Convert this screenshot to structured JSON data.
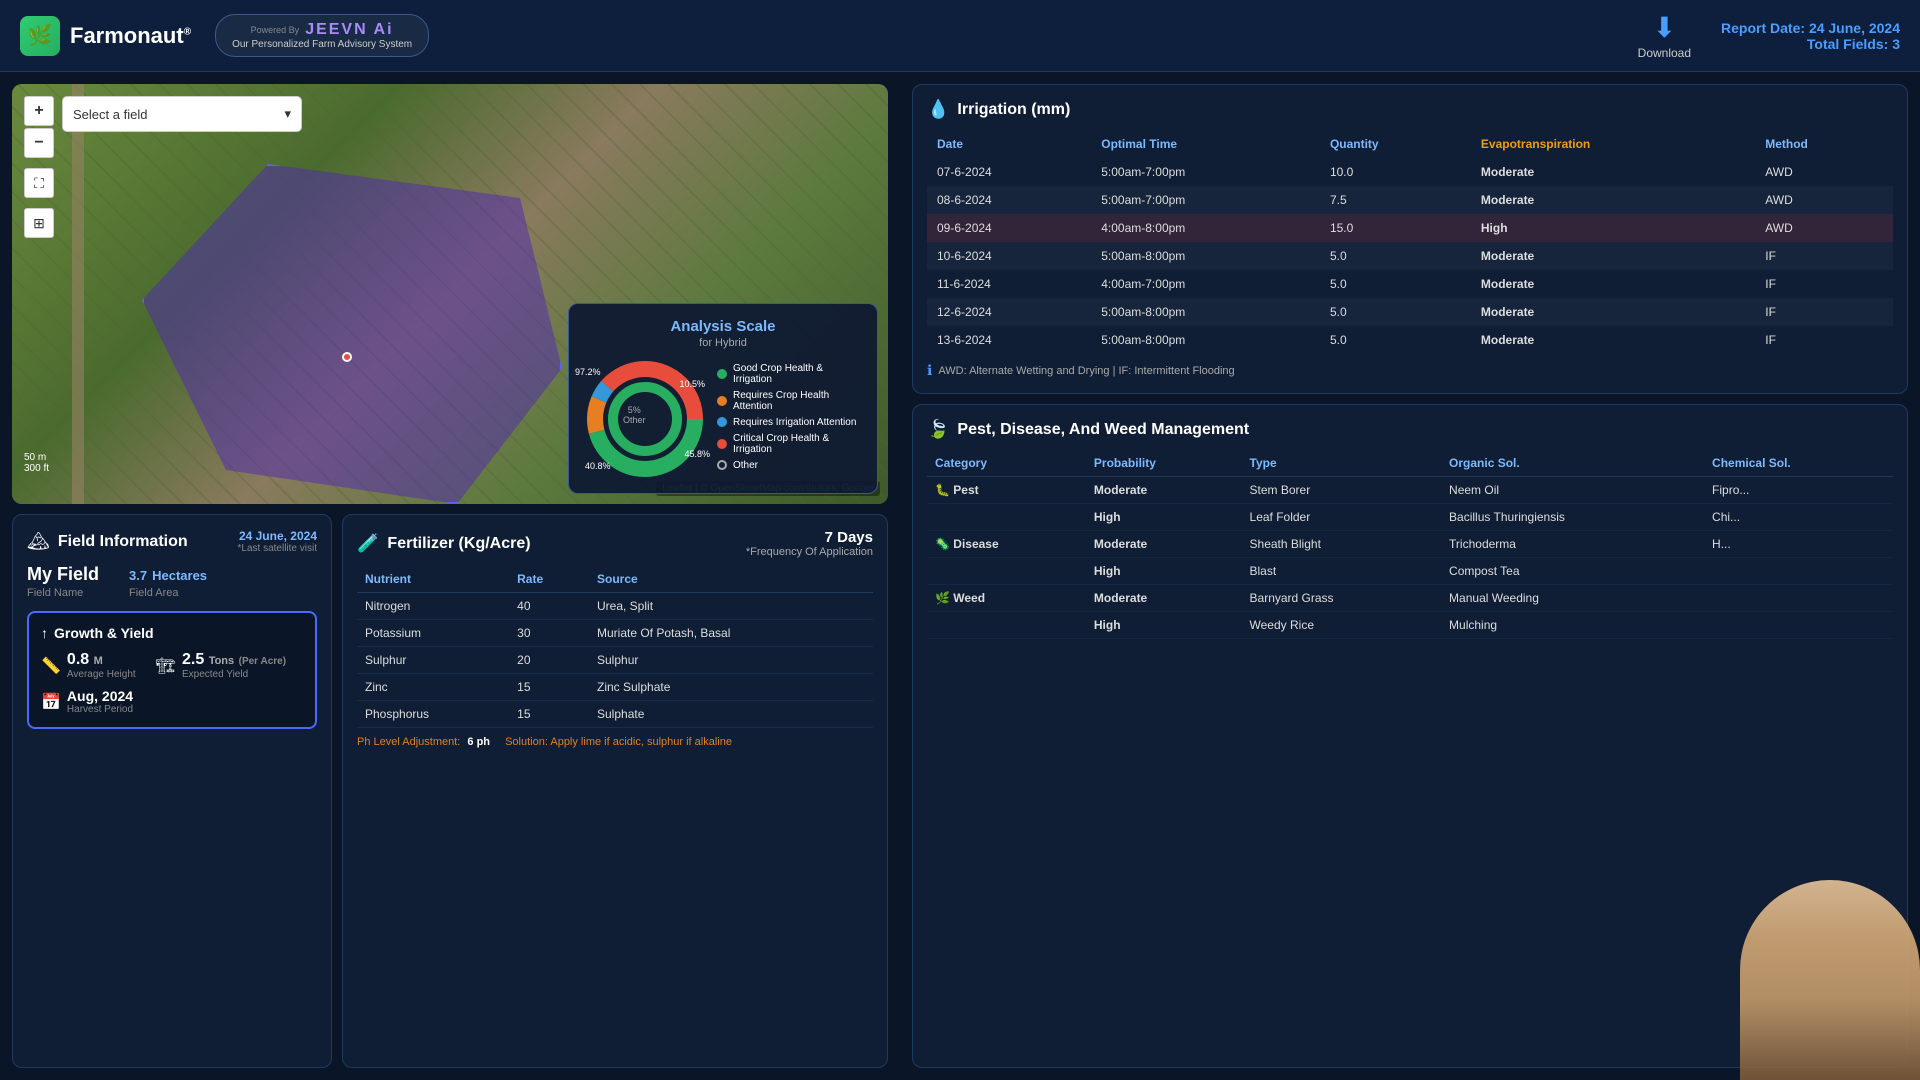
{
  "header": {
    "logo_text": "Farmonaut",
    "logo_reg": "®",
    "jeevn_title": "JEEVN Ai",
    "powered_by": "Powered By",
    "jeevn_subtitle": "Our Personalized Farm Advisory System",
    "download_label": "Download",
    "report_date_label": "Report Date:",
    "report_date_value": "24 June, 2024",
    "total_fields_label": "Total Fields:",
    "total_fields_value": "3"
  },
  "map": {
    "field_select_placeholder": "Select a field",
    "zoom_in": "+",
    "zoom_out": "−",
    "scale_50m": "50 m",
    "scale_300ft": "300 ft",
    "attribution": "Leaflet | © OpenStreetMap contributors, Google"
  },
  "analysis_scale": {
    "title": "Analysis Scale",
    "subtitle": "for Hybrid",
    "percentage_97": "97.2%",
    "percentage_105": "10.5%",
    "percentage_458": "45.8%",
    "percentage_5": "5%",
    "other_label": "Other",
    "percentage_408": "40.8%",
    "legend": [
      {
        "color": "#27ae60",
        "label": "Good Crop Health & Irrigation"
      },
      {
        "color": "#e67e22",
        "label": "Requires Crop Health Attention"
      },
      {
        "color": "#3498db",
        "label": "Requires Irrigation Attention"
      },
      {
        "color": "#e74c3c",
        "label": "Critical Crop Health & Irrigation"
      },
      {
        "color": "#ccc",
        "label": "Other",
        "type": "ring"
      }
    ]
  },
  "field_info": {
    "title": "Field Information",
    "date": "24 June, 2024",
    "date_label": "*Last satellite visit",
    "field_name": "My Field",
    "field_name_label": "Field Name",
    "field_area": "3.7",
    "field_area_unit": "Hectares",
    "field_area_label": "Field Area",
    "growth_title": "Growth & Yield",
    "avg_height": "0.8",
    "avg_height_unit": "M",
    "avg_height_label": "Average Height",
    "expected_yield": "2.5",
    "expected_yield_unit": "Tons",
    "expected_yield_per": "(Per Acre)",
    "expected_yield_label": "Expected Yield",
    "harvest_period": "Aug, 2024",
    "harvest_period_label": "Harvest Period"
  },
  "fertilizer": {
    "title": "Fertilizer (Kg/Acre)",
    "days": "7 Days",
    "freq_label": "*Frequency Of Application",
    "col_nutrient": "Nutrient",
    "col_rate": "Rate",
    "col_source": "Source",
    "rows": [
      {
        "nutrient": "Nitrogen",
        "rate": "40",
        "source": "Urea, Split"
      },
      {
        "nutrient": "Potassium",
        "rate": "30",
        "source": "Muriate Of Potash, Basal"
      },
      {
        "nutrient": "Sulphur",
        "rate": "20",
        "source": "Sulphur"
      },
      {
        "nutrient": "Zinc",
        "rate": "15",
        "source": "Zinc Sulphate"
      },
      {
        "nutrient": "Phosphorus",
        "rate": "15",
        "source": "Sulphate"
      }
    ],
    "ph_label": "Ph Level Adjustment:",
    "ph_value": "6 ph",
    "solution_label": "Solution:",
    "solution_value": "Apply lime if acidic, sulphur if alkaline"
  },
  "irrigation": {
    "title": "Irrigation (mm)",
    "col_date": "Date",
    "col_optimal_time": "Optimal Time",
    "col_quantity": "Quantity",
    "col_evap": "Evapotranspiration",
    "col_method": "Method",
    "rows": [
      {
        "date": "07-6-2024",
        "time": "5:00am-7:00pm",
        "qty": "10.0",
        "evap": "Moderate",
        "method": "AWD",
        "highlight": false
      },
      {
        "date": "08-6-2024",
        "time": "5:00am-7:00pm",
        "qty": "7.5",
        "evap": "Moderate",
        "method": "AWD",
        "highlight": false
      },
      {
        "date": "09-6-2024",
        "time": "4:00am-8:00pm",
        "qty": "15.0",
        "evap": "High",
        "method": "AWD",
        "highlight": true
      },
      {
        "date": "10-6-2024",
        "time": "5:00am-8:00pm",
        "qty": "5.0",
        "evap": "Moderate",
        "method": "IF",
        "highlight": false
      },
      {
        "date": "11-6-2024",
        "time": "4:00am-7:00pm",
        "qty": "5.0",
        "evap": "Moderate",
        "method": "IF",
        "highlight": false
      },
      {
        "date": "12-6-2024",
        "time": "5:00am-8:00pm",
        "qty": "5.0",
        "evap": "Moderate",
        "method": "IF",
        "highlight": false
      },
      {
        "date": "13-6-2024",
        "time": "5:00am-8:00pm",
        "qty": "5.0",
        "evap": "Moderate",
        "method": "IF",
        "highlight": false
      }
    ],
    "note": "AWD: Alternate Wetting and Drying | IF: Intermittent Flooding"
  },
  "pest": {
    "title": "Pest, Disease, And Weed Management",
    "col_category": "Category",
    "col_probability": "Probability",
    "col_type": "Type",
    "col_organic": "Organic Sol.",
    "col_chemical": "Chemical Sol.",
    "rows": [
      {
        "category": "Pest",
        "category_icon": "🐛",
        "prob": "Moderate",
        "prob_level": "moderate",
        "type": "Stem Borer",
        "organic": "Neem Oil",
        "chemical": "Fipro..."
      },
      {
        "category": "",
        "prob": "High",
        "prob_level": "high",
        "type": "Leaf Folder",
        "organic": "Bacillus Thuringiensis",
        "chemical": "Chi..."
      },
      {
        "category": "Disease",
        "category_icon": "🦠",
        "prob": "Moderate",
        "prob_level": "moderate",
        "type": "Sheath Blight",
        "organic": "Trichoderma",
        "chemical": "H..."
      },
      {
        "category": "",
        "prob": "High",
        "prob_level": "high",
        "type": "Blast",
        "organic": "Compost Tea",
        "chemical": ""
      },
      {
        "category": "Weed",
        "category_icon": "🌿",
        "prob": "Moderate",
        "prob_level": "moderate",
        "type": "Barnyard Grass",
        "organic": "Manual Weeding",
        "chemical": ""
      },
      {
        "category": "",
        "prob": "High",
        "prob_level": "high",
        "type": "Weedy Rice",
        "organic": "Mulching",
        "chemical": ""
      }
    ]
  },
  "colors": {
    "accent_blue": "#4a9eff",
    "accent_purple": "#a78bfa",
    "panel_bg": "#0f1e35",
    "header_bg": "#0d1f3c",
    "body_bg": "#0a1628",
    "moderate": "#f39c12",
    "high": "#e74c3c",
    "good": "#27ae60"
  }
}
